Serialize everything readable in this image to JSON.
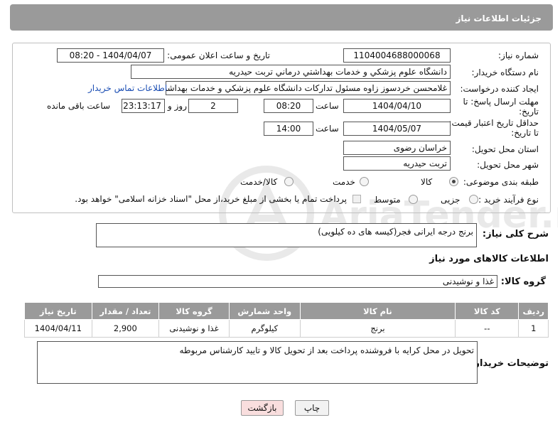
{
  "header": {
    "title": "جزئیات اطلاعات نیاز"
  },
  "form": {
    "need_number_label": "شماره نیاز:",
    "need_number": "1104004688000068",
    "announce_label": "تاریخ و ساعت اعلان عمومی:",
    "announce_value": "1404/04/07 - 08:20",
    "buyer_org_label": "نام دستگاه خریدار:",
    "buyer_org": "دانشگاه علوم پزشکي و خدمات بهداشتي درماني تربت حيدريه",
    "creator_label": "ایجاد کننده درخواست:",
    "creator": "غلامحسن خردسوز زاوه مسئول تدارکات دانشگاه علوم پزشکي و خدمات بهداشت",
    "contact_link": "اطلاعات تماس خریدار",
    "reply_deadline_label_1": "مهلت ارسال پاسخ: تا",
    "reply_deadline_label_2": "تاریخ:",
    "reply_date": "1404/04/10",
    "time_label": "ساعت",
    "reply_time": "08:20",
    "days": "2",
    "days_label": "روز و",
    "remaining": "23:13:17",
    "remaining_label": "ساعت باقی مانده",
    "price_deadline_label_1": "حداقل تاریخ اعتبار قیمت:",
    "price_deadline_label_2": "تا تاریخ:",
    "price_date": "1404/05/07",
    "price_time": "14:00",
    "province_label": "استان محل تحویل:",
    "province": "خراسان رضوی",
    "city_label": "شهر محل تحویل:",
    "city": "تربت حیدریه",
    "category_label": "طبقه بندی موضوعی:",
    "category_options": [
      "کالا",
      "خدمت",
      "کالا/خدمت"
    ],
    "category_selected": "کالا",
    "process_label": "نوع فرآیند خرید :",
    "process_options": [
      "جزیی",
      "متوسط"
    ],
    "payment_note": "پرداخت تمام یا بخشی از مبلغ خرید،از محل \"اسناد خزانه اسلامی\" خواهد بود."
  },
  "description": {
    "label": "شرح کلی نیاز:",
    "value": "برنج درجه ایرانی فجر(کیسه های ده کیلویی)"
  },
  "goods": {
    "title": "اطلاعات کالاهای مورد نیاز",
    "group_label": "گروه کالا:",
    "group_value": "غذا و نوشیدنی",
    "columns": [
      "ردیف",
      "کد کالا",
      "نام کالا",
      "واحد شمارش",
      "گروه کالا",
      "تعداد / مقدار",
      "تاریخ نیاز"
    ],
    "rows": [
      [
        "1",
        "--",
        "برنج",
        "کیلوگرم",
        "غذا و نوشیدنی",
        "2,900",
        "1404/04/11"
      ]
    ]
  },
  "buyer_notes": {
    "label": "توضیحات خریدار:",
    "value": "تحویل در محل کرایه با فروشنده پرداخت  بعد از تحویل کالا و تایید کارشناس مربوطه"
  },
  "buttons": {
    "print": "چاپ",
    "back": "بازگشت"
  },
  "watermark": {
    "text": "AriaTender.net"
  },
  "colors": {
    "header_bg": "#9a9a9a",
    "link": "#1a4db3",
    "back_button_bg": "#f9dede"
  }
}
